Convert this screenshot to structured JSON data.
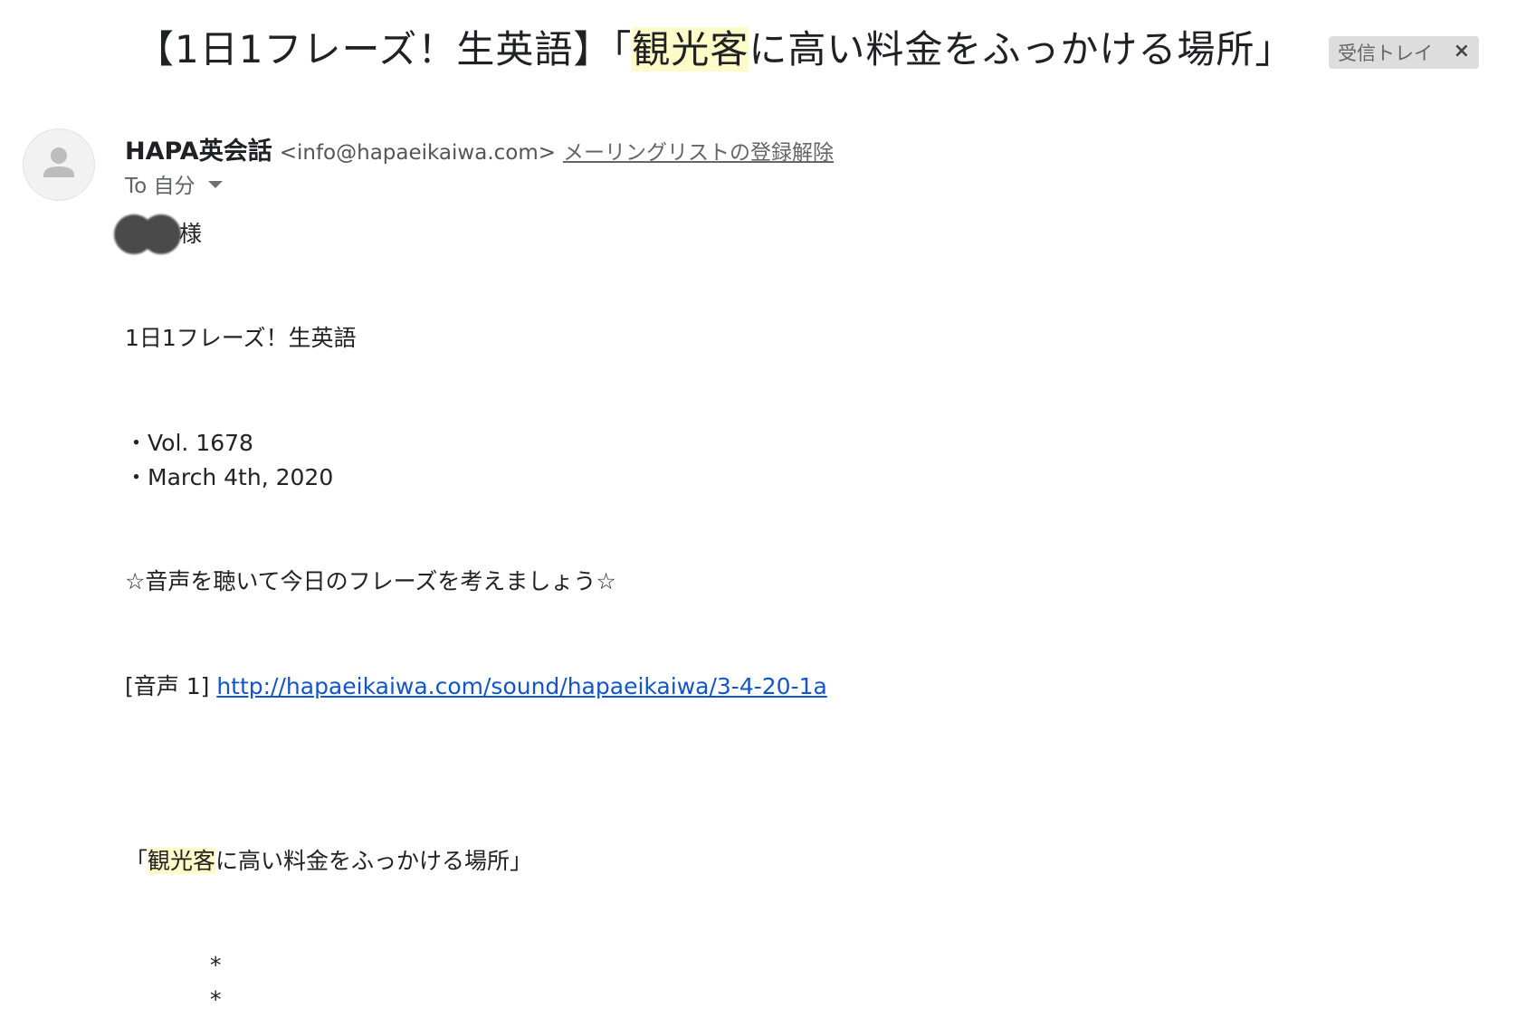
{
  "header": {
    "subject_before": "【1日1フレーズ！生英語】「",
    "subject_highlight": "観光客",
    "subject_after": "に高い料金をふっかける場所」",
    "label": "受信トレイ",
    "label_close": "×"
  },
  "sender": {
    "name": "HAPA英会話",
    "email": "<info@hapaeikaiwa.com>",
    "unsubscribe": "メーリングリストの登録解除",
    "to_label": "To 自分",
    "avatar_icon": "person-icon"
  },
  "body": {
    "greeting_suffix": "様",
    "newsletter_title": "1日1フレーズ！生英語",
    "vol": "・Vol. 1678",
    "date": "・March 4th, 2020",
    "listen_prompt": "☆音声を聴いて今日のフレーズを考えましょう☆",
    "audio_prefix": "[音声 1] ",
    "audio_link": "http://hapaeikaiwa.com/sound/hapaeikaiwa/3-4-20-1a",
    "phrase_open": "「",
    "phrase_highlight": "観光客",
    "phrase_rest": "に高い料金をふっかける場所」",
    "star1": "*",
    "star2": "*"
  },
  "colors": {
    "highlight": "#fdfbc8",
    "link": "#1155cc",
    "label_bg": "#dddddd"
  }
}
